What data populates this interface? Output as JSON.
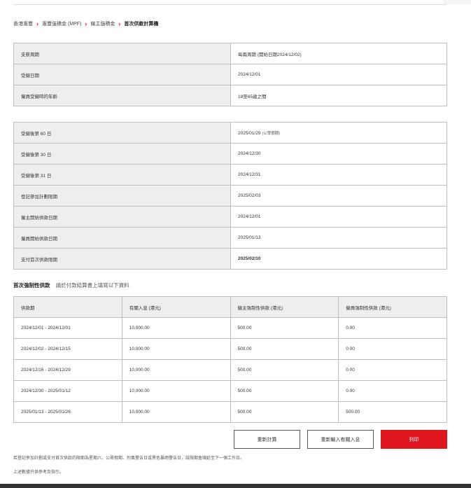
{
  "breadcrumb": {
    "items": [
      "香港滙豐",
      "滙豐強積金 (MPF)",
      "僱主強積金"
    ],
    "current": "首次供款計算機"
  },
  "summary_table": [
    {
      "label": "支薪周期",
      "value": "每兩周期 (開始日期2024/12/02)"
    },
    {
      "label": "受僱日期",
      "value": "2024/12/01"
    },
    {
      "label": "僱員受僱時的年齡",
      "value": "18至65歲之間"
    }
  ],
  "dates_table": [
    {
      "label": "受僱後第 60 日",
      "value": "2025/01/29",
      "note": "(公眾假期)"
    },
    {
      "label": "受僱後第 30 日",
      "value": "2024/12/30"
    },
    {
      "label": "受僱後第 31 日",
      "value": "2024/12/31"
    },
    {
      "label": "登記參加計劃限期",
      "value": "2025/02/03"
    },
    {
      "label": "僱主開始供款日期",
      "value": "2024/12/01"
    },
    {
      "label": "僱員開始供款日期",
      "value": "2025/01/13"
    },
    {
      "label": "支付首次供款限期",
      "value": "2025/02/10"
    }
  ],
  "contribution": {
    "title": "首次強制性供款",
    "subtitle": "請於付款結算書上填寫以下資料",
    "headers": [
      "供款期",
      "有關入息 (港元)",
      "僱主強制性供款 (港元)",
      "僱員強制性供款 (港元)"
    ],
    "rows": [
      [
        "2024/12/01 - 2024/12/01",
        "10,000.00",
        "500.00",
        "0.00"
      ],
      [
        "2024/12/02 - 2024/12/15",
        "10,000.00",
        "500.00",
        "0.00"
      ],
      [
        "2024/12/16 - 2024/12/29",
        "10,000.00",
        "500.00",
        "0.00"
      ],
      [
        "2024/12/30 - 2025/01/12",
        "10,000.00",
        "500.00",
        "0.00"
      ],
      [
        "2025/01/13 - 2025/01/26",
        "10,000.00",
        "500.00",
        "500.00"
      ]
    ]
  },
  "buttons": {
    "recalculate": "重新計算",
    "reenter": "重新輸入有關入息",
    "print": "列印"
  },
  "footnotes": [
    "若登記參加計劃或支付首次供款的限期為星期六、公眾假期、烈風警告日或黑色暴雨警告日，該限期會順延至下一個工作日。",
    "上述數據只供參考及指引。"
  ],
  "colors": {
    "accent": "#e0161e",
    "header_bg": "#eeeeee",
    "border": "#bfbfbf"
  }
}
